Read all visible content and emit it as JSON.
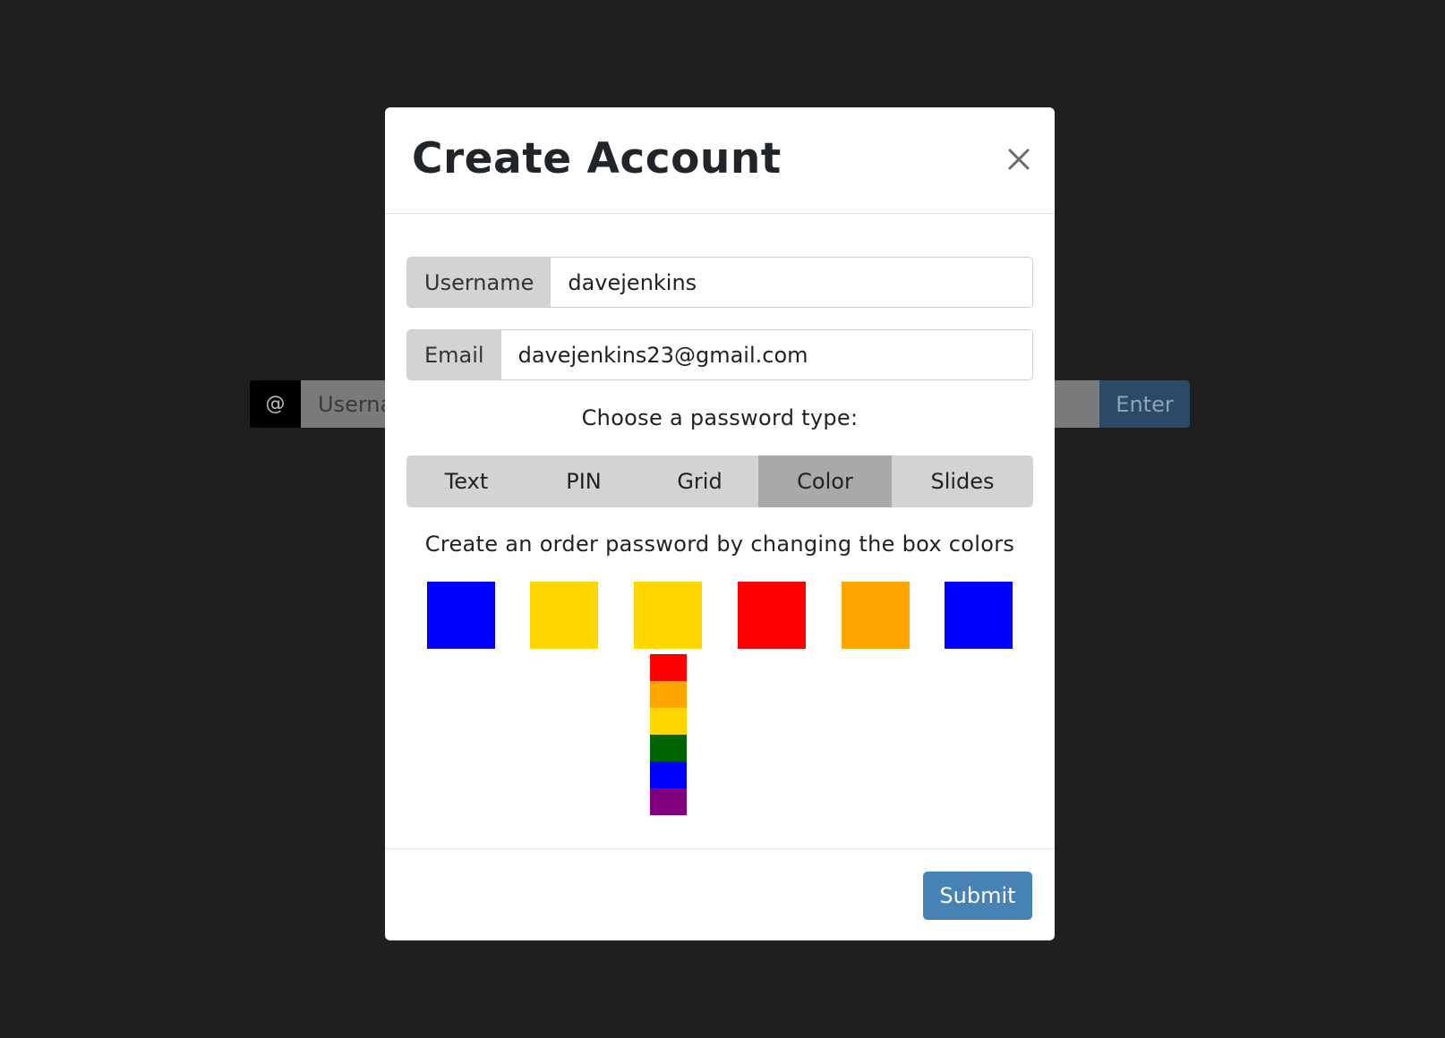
{
  "background": {
    "at_symbol": "@",
    "username_placeholder": "Userna",
    "enter_label": "Enter"
  },
  "modal": {
    "title": "Create Account",
    "close_icon": "close-icon",
    "username_label": "Username",
    "username_value": "davejenkins",
    "email_label": "Email",
    "email_value": "davejenkins23@gmail.com",
    "password_type_prompt": "Choose a password type:",
    "tabs": [
      {
        "label": "Text",
        "active": false
      },
      {
        "label": "PIN",
        "active": false
      },
      {
        "label": "Grid",
        "active": false
      },
      {
        "label": "Color",
        "active": true
      },
      {
        "label": "Slides",
        "active": false
      }
    ],
    "color_instruction": "Create an order password by changing the box colors",
    "color_boxes": [
      "#0000ff",
      "#ffd700",
      "#ffd700",
      "#ff0000",
      "#ffa500",
      "#0000ff"
    ],
    "palette_colors": [
      "#ff0000",
      "#ffa500",
      "#ffd700",
      "#006400",
      "#0000ff",
      "#800080"
    ],
    "submit_label": "Submit"
  },
  "colors": {
    "page_background": "#1f1f1f",
    "active_tab": "#a9a9a9",
    "tab_bar": "#d3d3d3",
    "submit": "#4682b4"
  }
}
